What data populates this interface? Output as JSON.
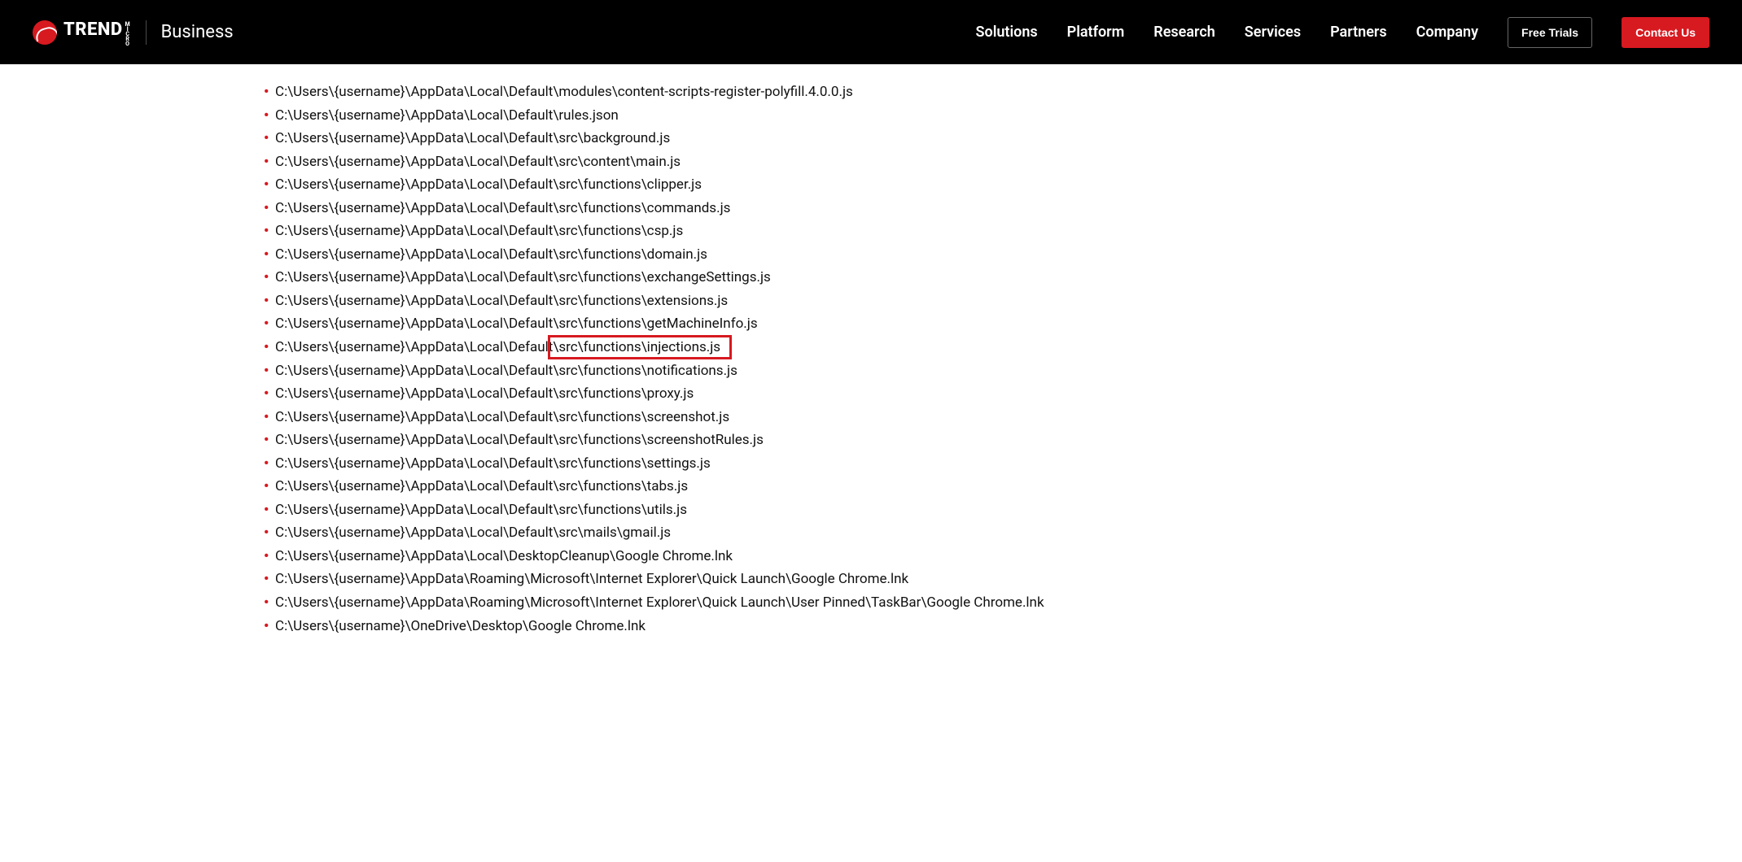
{
  "header": {
    "logo_text": "TREND",
    "logo_micro": "MICRO",
    "business": "Business",
    "nav": [
      "Solutions",
      "Platform",
      "Research",
      "Services",
      "Partners",
      "Company"
    ],
    "free_trials": "Free Trials",
    "contact": "Contact Us"
  },
  "files": [
    "C:\\Users\\{username}\\AppData\\Local\\Default\\modules\\content-scripts-register-polyfill.4.0.0.js",
    "C:\\Users\\{username}\\AppData\\Local\\Default\\rules.json",
    "C:\\Users\\{username}\\AppData\\Local\\Default\\src\\background.js",
    "C:\\Users\\{username}\\AppData\\Local\\Default\\src\\content\\main.js",
    "C:\\Users\\{username}\\AppData\\Local\\Default\\src\\functions\\clipper.js",
    "C:\\Users\\{username}\\AppData\\Local\\Default\\src\\functions\\commands.js",
    "C:\\Users\\{username}\\AppData\\Local\\Default\\src\\functions\\csp.js",
    "C:\\Users\\{username}\\AppData\\Local\\Default\\src\\functions\\domain.js",
    "C:\\Users\\{username}\\AppData\\Local\\Default\\src\\functions\\exchangeSettings.js",
    "C:\\Users\\{username}\\AppData\\Local\\Default\\src\\functions\\extensions.js",
    "C:\\Users\\{username}\\AppData\\Local\\Default\\src\\functions\\getMachineInfo.js",
    "C:\\Users\\{username}\\AppData\\Local\\Default\\src\\functions\\injections.js",
    "C:\\Users\\{username}\\AppData\\Local\\Default\\src\\functions\\notifications.js",
    "C:\\Users\\{username}\\AppData\\Local\\Default\\src\\functions\\proxy.js",
    "C:\\Users\\{username}\\AppData\\Local\\Default\\src\\functions\\screenshot.js",
    "C:\\Users\\{username}\\AppData\\Local\\Default\\src\\functions\\screenshotRules.js",
    "C:\\Users\\{username}\\AppData\\Local\\Default\\src\\functions\\settings.js",
    "C:\\Users\\{username}\\AppData\\Local\\Default\\src\\functions\\tabs.js",
    "C:\\Users\\{username}\\AppData\\Local\\Default\\src\\functions\\utils.js",
    "C:\\Users\\{username}\\AppData\\Local\\Default\\src\\mails\\gmail.js",
    "C:\\Users\\{username}\\AppData\\Local\\DesktopCleanup\\Google Chrome.lnk",
    "C:\\Users\\{username}\\AppData\\Roaming\\Microsoft\\Internet Explorer\\Quick Launch\\Google Chrome.lnk",
    "C:\\Users\\{username}\\AppData\\Roaming\\Microsoft\\Internet Explorer\\Quick Launch\\User Pinned\\TaskBar\\Google Chrome.lnk",
    "C:\\Users\\{username}\\OneDrive\\Desktop\\Google Chrome.lnk"
  ],
  "highlight": {
    "index": 11
  }
}
